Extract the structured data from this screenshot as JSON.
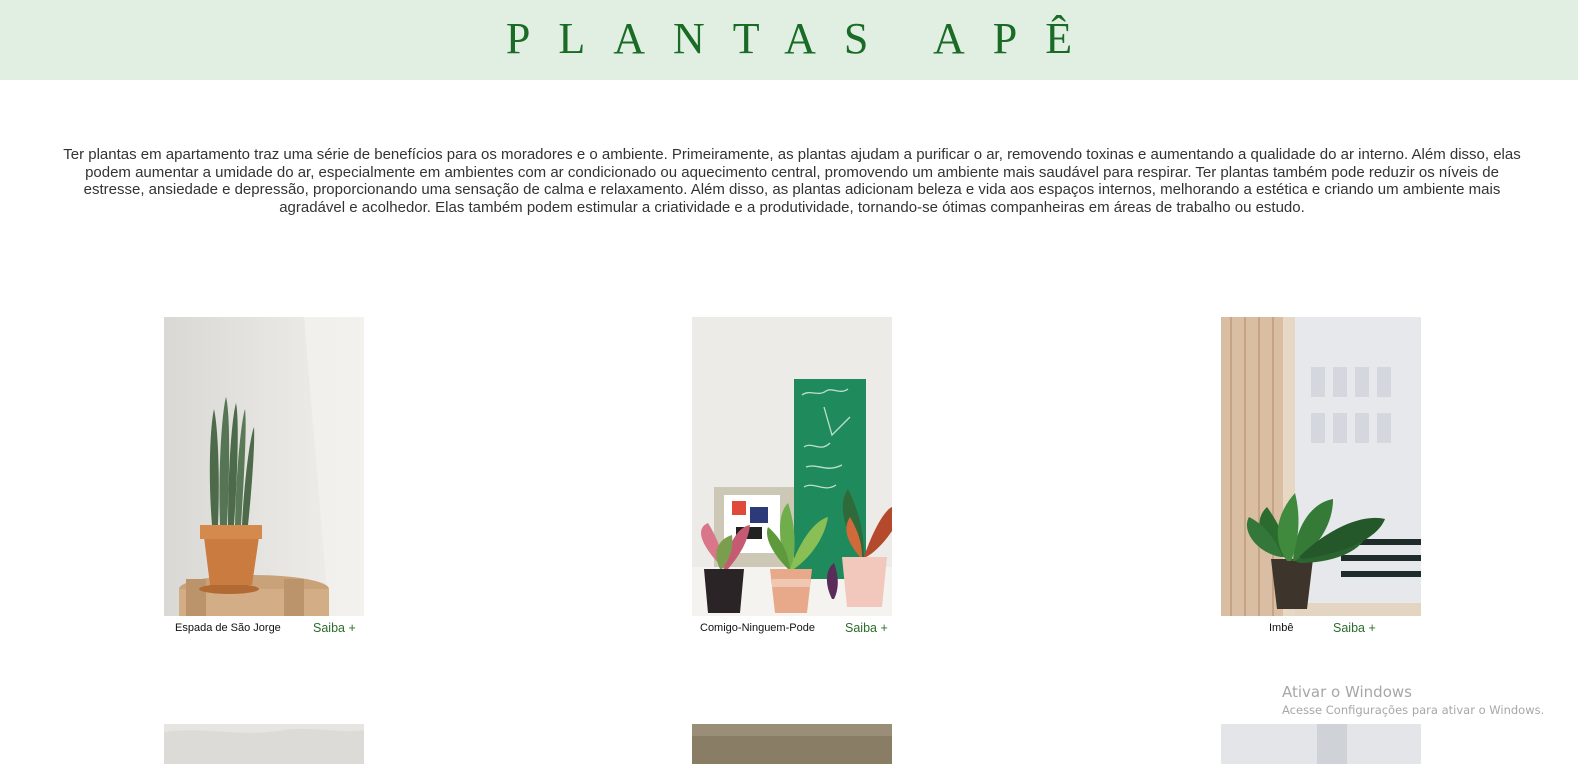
{
  "header": {
    "title": "PLANTAS APÊ",
    "background": "#e0efe2",
    "title_color": "#1a6b26"
  },
  "intro": {
    "text": "Ter plantas em apartamento traz uma série de benefícios para os moradores e o ambiente. Primeiramente, as plantas ajudam a purificar o ar, removendo toxinas e aumentando a qualidade do ar interno. Além disso, elas podem aumentar a umidade do ar, especialmente em ambientes com ar condicionado ou aquecimento central, promovendo um ambiente mais saudável para respirar. Ter plantas também pode reduzir os níveis de estresse, ansiedade e depressão, proporcionando uma sensação de calma e relaxamento. Além disso, as plantas adicionam beleza e vida aos espaços internos, melhorando a estética e criando um ambiente mais agradável e acolhedor. Elas também podem estimular a criatividade e a produtividade, tornando-se ótimas companheiras em áreas de trabalho ou estudo."
  },
  "plants": [
    {
      "name": "Espada de São Jorge",
      "link": "Saiba +"
    },
    {
      "name": "Comigo-Ninguem-Pode",
      "link": "Saiba +"
    },
    {
      "name": "Imbê",
      "link": "Saiba +"
    }
  ],
  "watermark": {
    "line1": "Ativar o Windows",
    "line2": "Acesse Configurações para ativar o Windows."
  },
  "colors": {
    "link": "#2b6d2b",
    "body_text": "#333333"
  }
}
